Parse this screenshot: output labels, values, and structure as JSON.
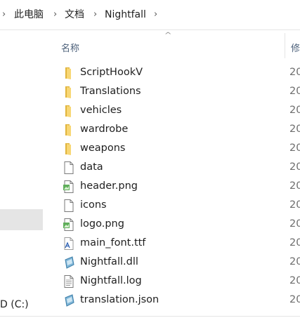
{
  "breadcrumb": {
    "items": [
      "此电脑",
      "文档",
      "Nightfall"
    ],
    "separator": "›"
  },
  "nav": {
    "drive_label": "D (C:)"
  },
  "columns": {
    "name": "名称",
    "date_modified": "修"
  },
  "files": [
    {
      "name": "ScriptHookV",
      "type": "folder",
      "date": "20"
    },
    {
      "name": "Translations",
      "type": "folder",
      "date": "20"
    },
    {
      "name": "vehicles",
      "type": "folder",
      "date": "20"
    },
    {
      "name": "wardrobe",
      "type": "folder",
      "date": "20"
    },
    {
      "name": "weapons",
      "type": "folder",
      "date": "20"
    },
    {
      "name": "data",
      "type": "file",
      "date": "20"
    },
    {
      "name": "header.png",
      "type": "image",
      "date": "20"
    },
    {
      "name": "icons",
      "type": "file",
      "date": "20"
    },
    {
      "name": "logo.png",
      "type": "image",
      "date": "20"
    },
    {
      "name": "main_font.ttf",
      "type": "font",
      "date": "20"
    },
    {
      "name": "Nightfall.dll",
      "type": "dll",
      "date": "20"
    },
    {
      "name": "Nightfall.log",
      "type": "text",
      "date": "20"
    },
    {
      "name": "translation.json",
      "type": "json",
      "date": "20"
    }
  ],
  "colors": {
    "folder": "#f8d775",
    "folder_dark": "#e0b43c",
    "header_text": "#4c607a",
    "selection": "#e5e5e5"
  }
}
